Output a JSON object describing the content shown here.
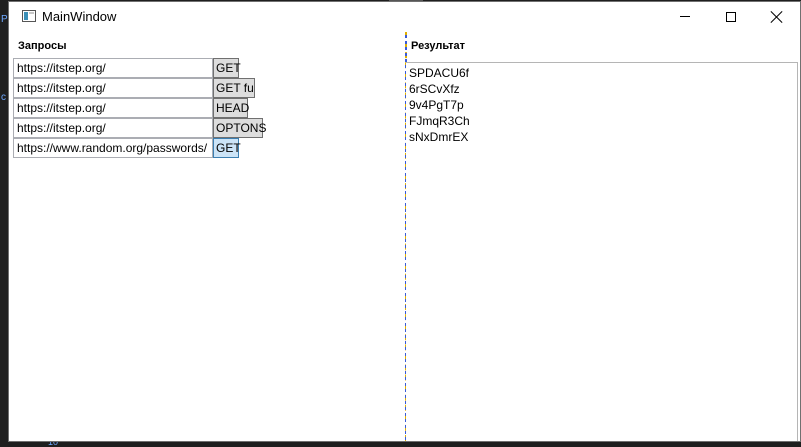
{
  "window": {
    "title": "MainWindow"
  },
  "left_pane": {
    "header": "Запросы",
    "requests": [
      {
        "url": "https://itstep.org/",
        "button": "GET"
      },
      {
        "url": "https://itstep.org/",
        "button": "GET ful"
      },
      {
        "url": "https://itstep.org/",
        "button": "HEAD"
      },
      {
        "url": "https://itstep.org/",
        "button": "OPTONS"
      },
      {
        "url": "https://www.random.org/passwords/",
        "button": "GET"
      }
    ]
  },
  "right_pane": {
    "header": "Результат",
    "result_lines": [
      "SPDACU6f",
      "6rSCvXfz",
      "9v4PgT7p",
      "FJmqR3Ch",
      "sNxDmrEX"
    ]
  },
  "background": {
    "glyphs": [
      "Pr",
      "c"
    ],
    "line_number": "10"
  },
  "colors": {
    "focused_button": "#cce4f7",
    "splitter_yellow": "#e0b000",
    "splitter_blue": "#3a5bd9"
  }
}
